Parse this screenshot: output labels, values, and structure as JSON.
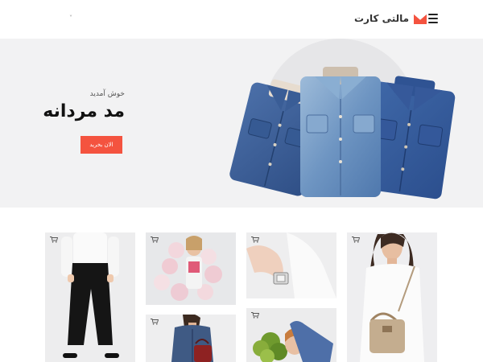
{
  "header": {
    "brand_name": "مالتی کارت",
    "caret": "˅",
    "logo_color": "#f4533f"
  },
  "hero": {
    "welcome_text": "خوش آمدید",
    "title": "مد مردانه",
    "cta_label": "الان بخرید",
    "accent_color": "#f4533f"
  },
  "products": {
    "icons": [
      "cart-icon"
    ]
  }
}
